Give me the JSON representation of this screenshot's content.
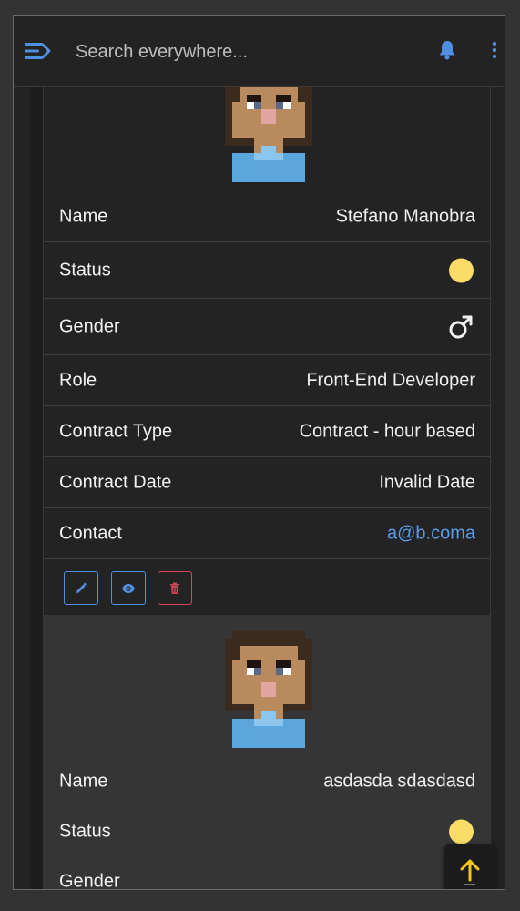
{
  "search": {
    "placeholder": "Search everywhere..."
  },
  "colors": {
    "accent": "#4f8ee0",
    "danger": "#d9445a",
    "status_yellow": "#fbdc69",
    "link": "#5b9bea",
    "scroll_arrow": "#f5c518"
  },
  "icons": {
    "menu": "menu-arrow-icon",
    "bell": "bell-icon",
    "more": "more-vertical-icon",
    "gender": "male-symbol-icon",
    "edit": "pencil-icon",
    "view": "eye-icon",
    "delete": "trash-icon",
    "scroll_top": "arrow-up-icon"
  },
  "employees": [
    {
      "name_label": "Name",
      "name": "Stefano Manobra",
      "status_label": "Status",
      "gender_label": "Gender",
      "role_label": "Role",
      "role": "Front-End Developer",
      "contract_type_label": "Contract Type",
      "contract_type": "Contract - hour based",
      "contract_date_label": "Contract Date",
      "contract_date": "Invalid Date",
      "contact_label": "Contact",
      "contact": "a@b.coma"
    },
    {
      "name_label": "Name",
      "name": "asdasda sdasdasd",
      "status_label": "Status",
      "gender_label": "Gender"
    }
  ]
}
